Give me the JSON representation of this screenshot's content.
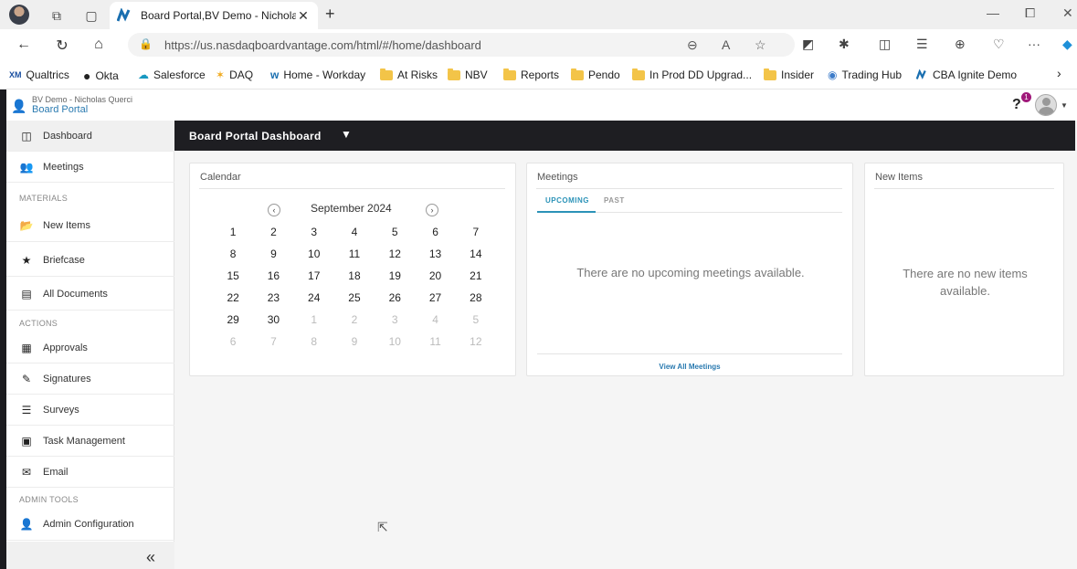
{
  "browser": {
    "tab_title": "Board Portal,BV Demo - Nicholas",
    "url": "https://us.nasdaqboardvantage.com/html/#/home/dashboard",
    "bookmarks": [
      {
        "label": "Qualtrics",
        "icon": "XM"
      },
      {
        "label": "Okta",
        "icon": "okta-icon"
      },
      {
        "label": "Salesforce",
        "icon": "salesforce-icon"
      },
      {
        "label": "DAQ",
        "icon": "daq-icon"
      },
      {
        "label": "Home - Workday",
        "icon": "workday-icon"
      },
      {
        "label": "At Risks",
        "icon": "folder-icon"
      },
      {
        "label": "NBV",
        "icon": "folder-icon"
      },
      {
        "label": "Reports",
        "icon": "folder-icon"
      },
      {
        "label": "Pendo",
        "icon": "folder-icon"
      },
      {
        "label": "In Prod DD Upgrad...",
        "icon": "folder-icon"
      },
      {
        "label": "Insider",
        "icon": "folder-icon"
      },
      {
        "label": "Trading Hub",
        "icon": "globe-icon"
      },
      {
        "label": "CBA Ignite Demo",
        "icon": "nbv-icon"
      }
    ]
  },
  "header": {
    "user_name": "BV Demo - Nicholas Querci",
    "portal_name": "Board Portal",
    "help_label": "?",
    "notification_count": "1"
  },
  "sidebar": {
    "items": [
      {
        "label": "Dashboard",
        "icon": "dashboard-icon"
      },
      {
        "label": "Meetings",
        "icon": "people-icon"
      },
      {
        "label": "New Items",
        "icon": "folder-open-icon"
      },
      {
        "label": "Briefcase",
        "icon": "star-icon"
      },
      {
        "label": "All Documents",
        "icon": "document-icon"
      },
      {
        "label": "Approvals",
        "icon": "calendar-check-icon"
      },
      {
        "label": "Signatures",
        "icon": "signature-icon"
      },
      {
        "label": "Surveys",
        "icon": "list-icon"
      },
      {
        "label": "Task Management",
        "icon": "clipboard-icon"
      },
      {
        "label": "Email",
        "icon": "envelope-icon"
      },
      {
        "label": "Admin Configuration",
        "icon": "user-gear-icon"
      }
    ],
    "sections": {
      "materials": "MATERIALS",
      "actions": "ACTIONS",
      "admin_tools": "ADMIN TOOLS"
    },
    "collapse_label": "«"
  },
  "dashboard": {
    "title": "Board Portal Dashboard",
    "calendar": {
      "title": "Calendar",
      "month": "September 2024",
      "weeks": [
        [
          {
            "d": "1",
            "m": false
          },
          {
            "d": "2",
            "m": false
          },
          {
            "d": "3",
            "m": false
          },
          {
            "d": "4",
            "m": false
          },
          {
            "d": "5",
            "m": false
          },
          {
            "d": "6",
            "m": false
          },
          {
            "d": "7",
            "m": false
          }
        ],
        [
          {
            "d": "8",
            "m": false
          },
          {
            "d": "9",
            "m": false
          },
          {
            "d": "10",
            "m": false
          },
          {
            "d": "11",
            "m": false
          },
          {
            "d": "12",
            "m": false
          },
          {
            "d": "13",
            "m": false
          },
          {
            "d": "14",
            "m": false
          }
        ],
        [
          {
            "d": "15",
            "m": false
          },
          {
            "d": "16",
            "m": false
          },
          {
            "d": "17",
            "m": false
          },
          {
            "d": "18",
            "m": false
          },
          {
            "d": "19",
            "m": false
          },
          {
            "d": "20",
            "m": false
          },
          {
            "d": "21",
            "m": false
          }
        ],
        [
          {
            "d": "22",
            "m": false
          },
          {
            "d": "23",
            "m": false
          },
          {
            "d": "24",
            "m": false
          },
          {
            "d": "25",
            "m": false
          },
          {
            "d": "26",
            "m": false
          },
          {
            "d": "27",
            "m": false
          },
          {
            "d": "28",
            "m": false
          }
        ],
        [
          {
            "d": "29",
            "m": false
          },
          {
            "d": "30",
            "m": false
          },
          {
            "d": "1",
            "m": true
          },
          {
            "d": "2",
            "m": true
          },
          {
            "d": "3",
            "m": true
          },
          {
            "d": "4",
            "m": true
          },
          {
            "d": "5",
            "m": true
          }
        ],
        [
          {
            "d": "6",
            "m": true
          },
          {
            "d": "7",
            "m": true
          },
          {
            "d": "8",
            "m": true
          },
          {
            "d": "9",
            "m": true
          },
          {
            "d": "10",
            "m": true
          },
          {
            "d": "11",
            "m": true
          },
          {
            "d": "12",
            "m": true
          }
        ]
      ]
    },
    "meetings": {
      "title": "Meetings",
      "tab_upcoming": "UPCOMING",
      "tab_past": "PAST",
      "empty": "There are no upcoming meetings available.",
      "view_all": "View All Meetings"
    },
    "new_items": {
      "title": "New Items",
      "empty": "There are no new items available."
    }
  },
  "colors": {
    "accent": "#2c93b8",
    "link": "#2a7ab0",
    "dark_bar": "#1e1e22",
    "badge": "#a0197a"
  }
}
